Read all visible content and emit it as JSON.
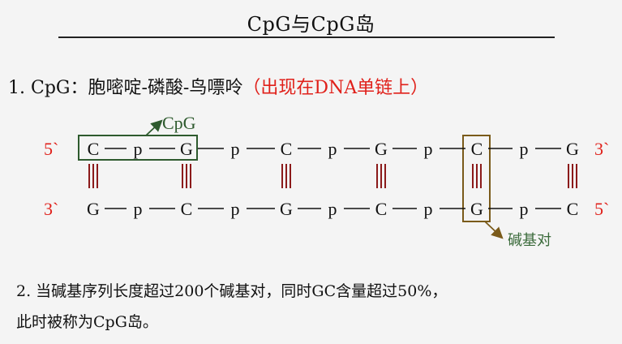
{
  "title": "CpG与CpG岛",
  "item1": {
    "prefix": "1. CpG：胞嘧啶-磷酸-鸟嘌呤",
    "paren_open": "（",
    "note": "出现在DNA单链上",
    "paren_close": "）"
  },
  "diagram": {
    "top_strand": {
      "end_left": "5`",
      "end_right": "3`",
      "bases": [
        "C",
        "G",
        "C",
        "G",
        "C",
        "G"
      ],
      "linker": "p"
    },
    "bottom_strand": {
      "end_left": "3`",
      "end_right": "5`",
      "bases": [
        "G",
        "C",
        "G",
        "C",
        "G",
        "C"
      ],
      "linker": "p"
    },
    "labels": {
      "cpg": "CpG",
      "base_pair": "碱基对"
    },
    "colors": {
      "end_label": "#e0201a",
      "cpg_box": "#2e5a2e",
      "base_pair_box": "#7a5a1a",
      "h_bond": "#8b1a1a",
      "label_text": "#3a6a3a"
    }
  },
  "item2": {
    "line1": "2. 当碱基序列长度超过200个碱基对，同时GC含量超过50%，",
    "line2": "此时被称为CpG岛。"
  }
}
